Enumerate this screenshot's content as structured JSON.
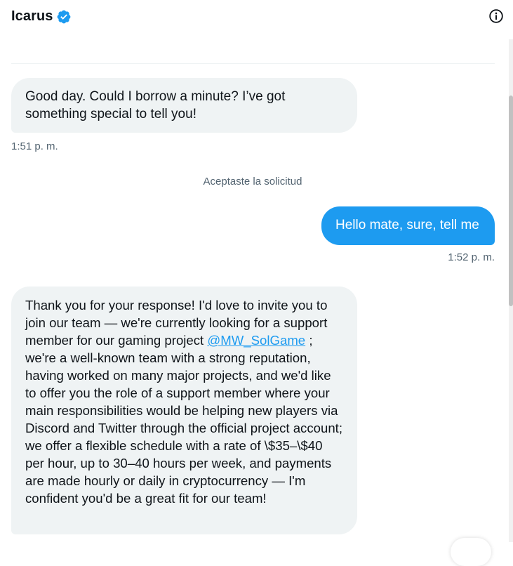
{
  "header": {
    "title": "Icarus",
    "verified_icon": "verified-badge-icon",
    "info_icon": "info-circle-icon"
  },
  "messages": {
    "msg1": {
      "text": "Good day.  Could I borrow a minute?   I’ve got something special to tell you!",
      "time": "1:51 p. m."
    },
    "system_notice": "Aceptaste la solicitud",
    "msg2": {
      "text": "Hello mate, sure, tell me",
      "time": "1:52 p. m."
    },
    "msg3": {
      "text_before": "Thank you for your response! I'd love to invite you to join our team — we're currently looking for a support member for our gaming project ",
      "mention": "@MW_SolGame",
      "text_after": " ; we're a well-known team with a strong reputation, having worked on many major projects, and we'd like to offer you the role of a support member where your main responsibilities would be helping new players via Discord and Twitter through the official project account; we offer a flexible schedule with a rate of \\$35–\\$40 per hour, up to 30–40 hours per week, and payments are made hourly or daily in cryptocurrency — I'm confident you'd be a great fit for our team!"
    }
  },
  "colors": {
    "accent": "#1d9bf0",
    "incoming_bubble": "#eff3f4",
    "muted_text": "#536471"
  }
}
